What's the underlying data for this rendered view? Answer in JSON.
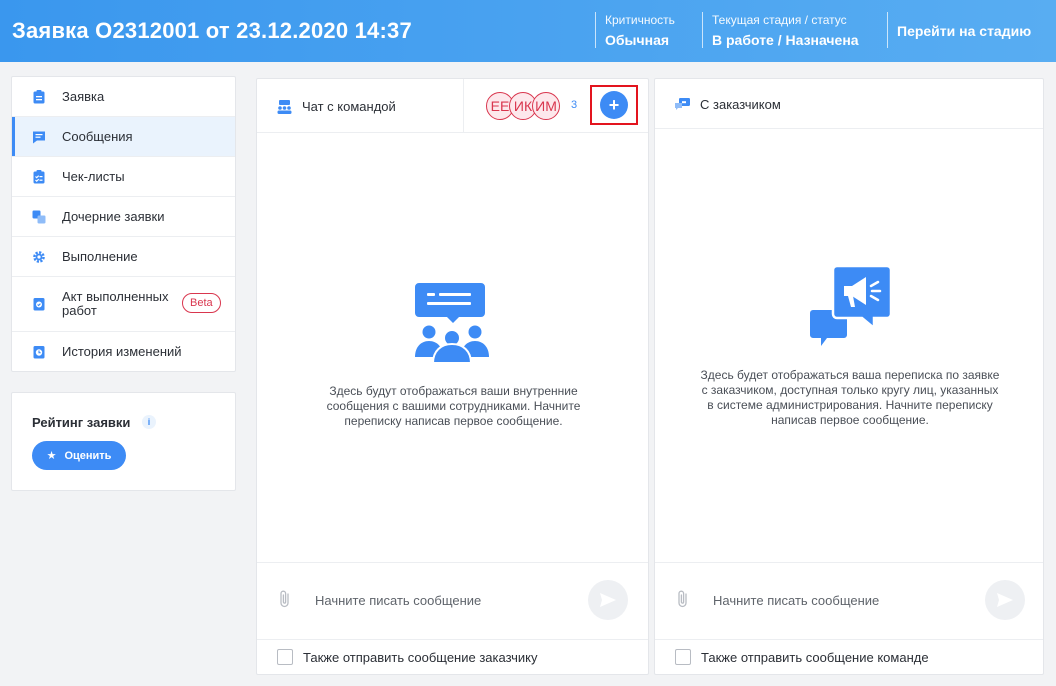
{
  "header": {
    "title": "Заявка О2312001 от 23.12.2020 14:37",
    "criticality_label": "Критичность",
    "criticality_value": "Обычная",
    "stage_label": "Текущая стадия / статус",
    "stage_value": "В работе / Назначена",
    "goto_stage": "Перейти на стадию"
  },
  "sidebar": {
    "items": [
      {
        "label": "Заявка",
        "icon": "clipboard-icon",
        "active": false
      },
      {
        "label": "Сообщения",
        "icon": "message-icon",
        "active": true
      },
      {
        "label": "Чек-листы",
        "icon": "checklist-icon",
        "active": false
      },
      {
        "label": "Дочерние заявки",
        "icon": "child-requests-icon",
        "active": false
      },
      {
        "label": "Выполнение",
        "icon": "gear-icon",
        "active": false
      },
      {
        "label": "Акт выполненных работ",
        "icon": "act-icon",
        "active": false,
        "badge": "Beta"
      },
      {
        "label": "История изменений",
        "icon": "history-icon",
        "active": false
      }
    ]
  },
  "rating": {
    "title": "Рейтинг заявки",
    "info": "i",
    "button": "Оценить"
  },
  "team_chat": {
    "title": "Чат с командой",
    "avatars": [
      "ЕЕ",
      "ИК",
      "ИМ"
    ],
    "participants_count": "3",
    "add_label": "+",
    "empty_text": "Здесь будут отображаться ваши внутренние сообщения с вашими сотрудниками. Начните переписку написав первое сообщение.",
    "placeholder": "Начните писать сообщение",
    "also_send": "Также отправить сообщение заказчику"
  },
  "customer_chat": {
    "title": "С заказчиком",
    "empty_text": "Здесь будет отображаться ваша переписка по заявке с заказчиком, доступная только кругу лиц, указанных в системе администрирования. Начните переписку написав первое сообщение.",
    "placeholder": "Начните писать сообщение",
    "also_send": "Также отправить сообщение команде"
  },
  "colors": {
    "accent": "#3d8bf5",
    "header_start": "#3a97ee",
    "header_end": "#58adf2",
    "avatar_red": "#d9364e",
    "highlight_red": "#e3141e"
  }
}
